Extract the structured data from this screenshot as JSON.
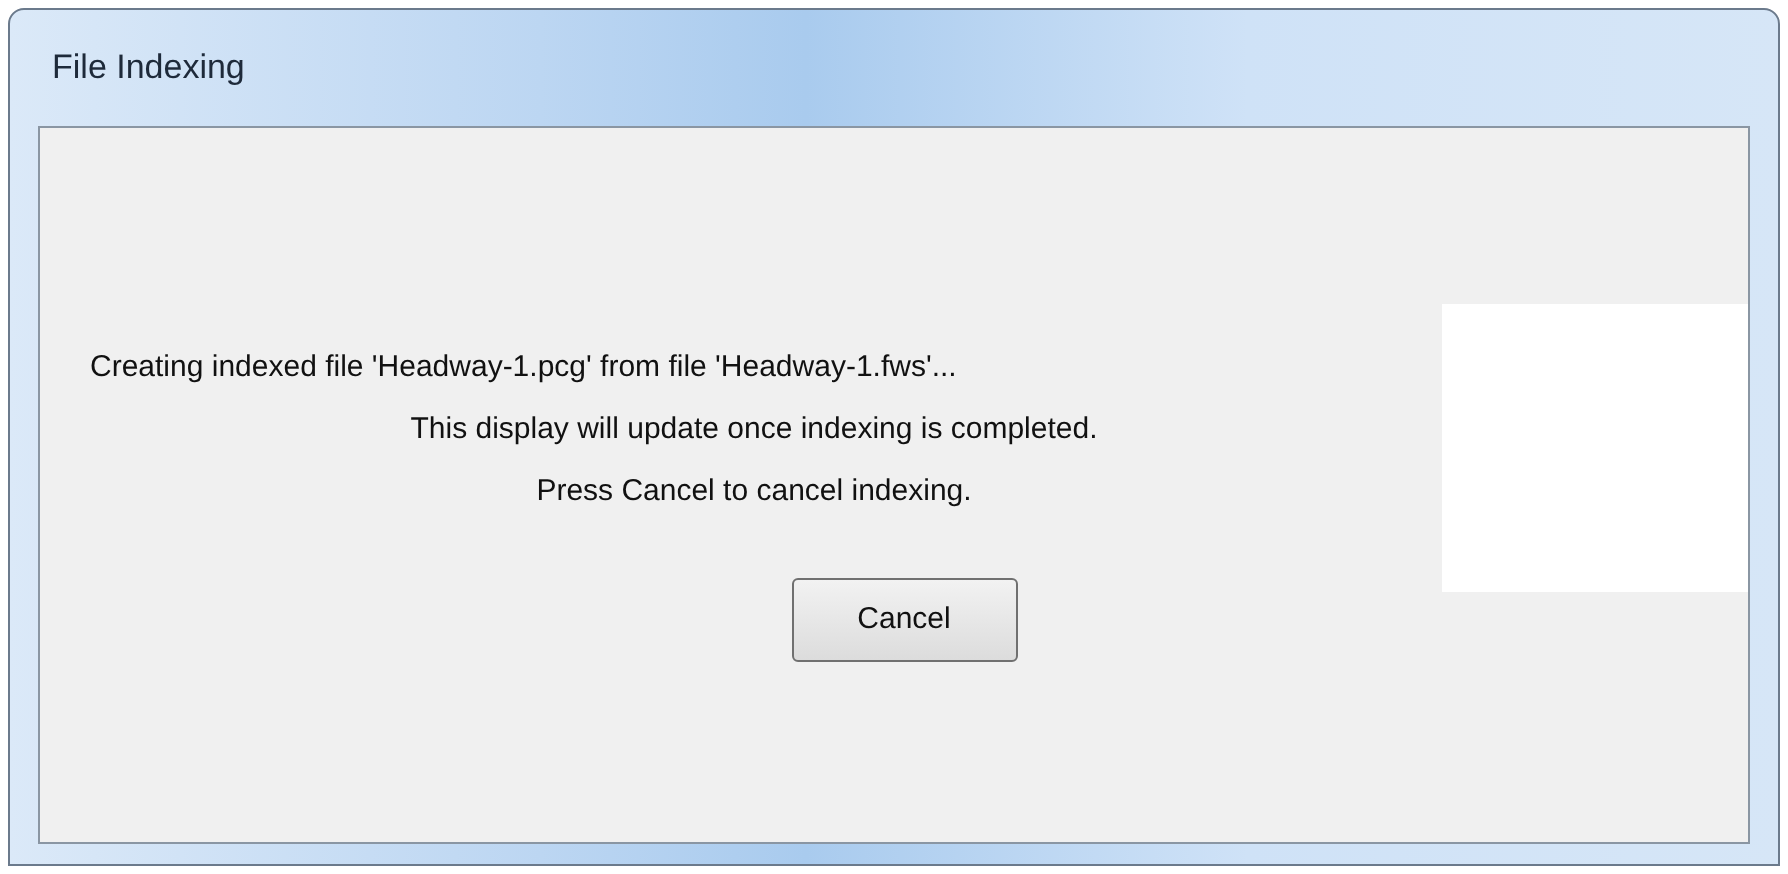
{
  "window": {
    "title": "File Indexing"
  },
  "messages": [
    {
      "text": "Creating indexed file 'Headway-1.pcg' from file 'Headway-1.fws'...",
      "kind": "status"
    },
    {
      "text": "This display will update once indexing is completed.",
      "kind": "note"
    },
    {
      "text": "Press Cancel to cancel indexing.",
      "kind": "note"
    }
  ],
  "buttons": [
    "Cancel"
  ]
}
